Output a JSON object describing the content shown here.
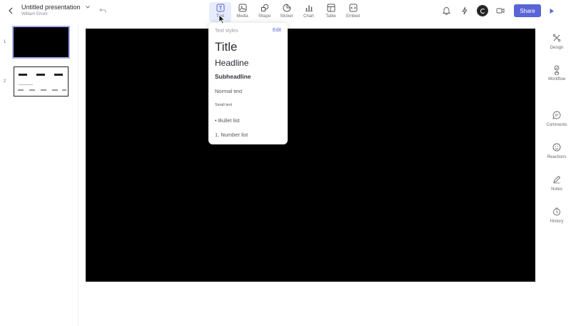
{
  "document": {
    "title": "Untitled presentation",
    "owner": "William Enom"
  },
  "toolbar": {
    "insert_tools": [
      {
        "label": "Text",
        "icon": "text-icon",
        "active": true
      },
      {
        "label": "Media",
        "icon": "media-icon",
        "active": false
      },
      {
        "label": "Shape",
        "icon": "shape-icon",
        "active": false
      },
      {
        "label": "Sticker",
        "icon": "sticker-icon",
        "active": false
      },
      {
        "label": "Chart",
        "icon": "chart-icon",
        "active": false
      },
      {
        "label": "Table",
        "icon": "table-icon",
        "active": false
      },
      {
        "label": "Embed",
        "icon": "embed-icon",
        "active": false
      }
    ],
    "share_label": "Share"
  },
  "slides": [
    {
      "number": "1"
    },
    {
      "number": "2"
    }
  ],
  "text_styles": {
    "header": "Text styles",
    "edit_label": "Edit",
    "items": [
      {
        "label": "Title"
      },
      {
        "label": "Headline"
      },
      {
        "label": "Subheadline"
      },
      {
        "label": "Normal text"
      },
      {
        "label": "Small text"
      },
      {
        "label": "• Bullet list"
      },
      {
        "label": "1. Number list"
      }
    ]
  },
  "right_rail": {
    "items": [
      {
        "label": "Design",
        "icon": "design-icon"
      },
      {
        "label": "Workflow",
        "icon": "workflow-icon"
      },
      {
        "label": "Comments",
        "icon": "comments-icon"
      },
      {
        "label": "Reactions",
        "icon": "reactions-icon"
      },
      {
        "label": "Notes",
        "icon": "notes-icon"
      },
      {
        "label": "History",
        "icon": "history-icon"
      }
    ]
  },
  "colors": {
    "accent": "#5a64d6",
    "canvas": "#000000",
    "active_tool_bg": "#e6ecfb"
  }
}
